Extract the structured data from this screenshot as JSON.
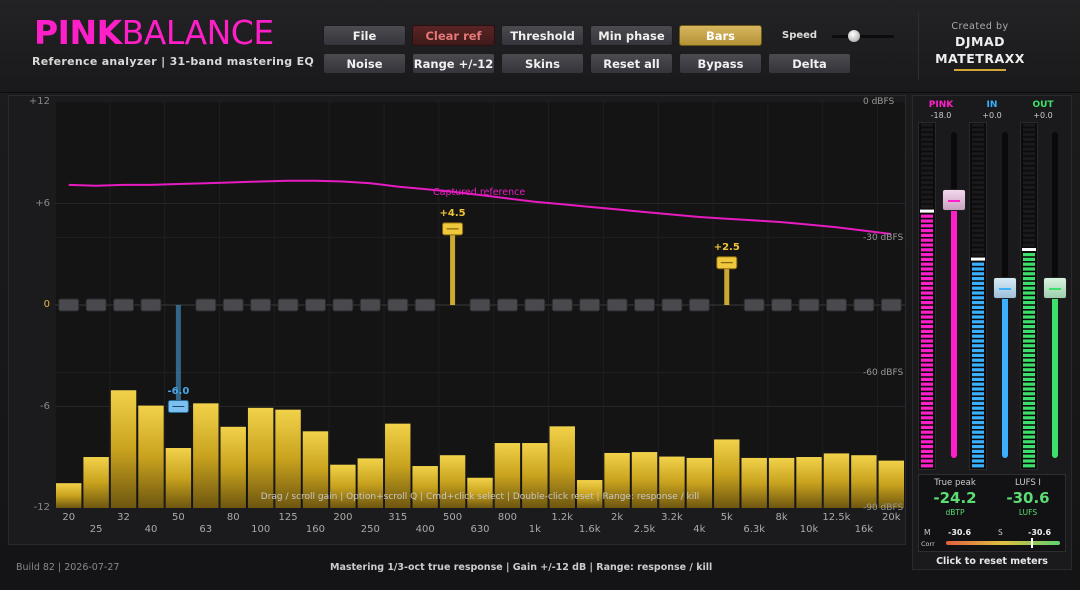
{
  "brand": {
    "name_bold": "PINK",
    "name_light": "BALANCE",
    "subtitle": "Reference analyzer  |  31-band mastering EQ"
  },
  "toolbar": {
    "row1": [
      {
        "id": "file",
        "label": "File",
        "state": "normal"
      },
      {
        "id": "clear-ref",
        "label": "Clear ref",
        "state": "alert"
      },
      {
        "id": "threshold",
        "label": "Threshold",
        "state": "normal"
      },
      {
        "id": "min-phase",
        "label": "Min phase",
        "state": "normal"
      },
      {
        "id": "bars",
        "label": "Bars",
        "state": "active"
      }
    ],
    "row2": [
      {
        "id": "noise",
        "label": "Noise",
        "state": "normal"
      },
      {
        "id": "range",
        "label": "Range +/-12",
        "state": "normal"
      },
      {
        "id": "skins",
        "label": "Skins",
        "state": "normal"
      },
      {
        "id": "reset-all",
        "label": "Reset all",
        "state": "normal"
      },
      {
        "id": "bypass",
        "label": "Bypass",
        "state": "normal"
      },
      {
        "id": "delta",
        "label": "Delta",
        "state": "normal"
      }
    ],
    "speed_label": "Speed",
    "speed_value": 0.35
  },
  "credits": {
    "created_by": "Created by",
    "author_line1": "DJMAD",
    "author_line2": "MATETRAXX"
  },
  "graph": {
    "y_left_ticks": [
      "+12",
      "+6",
      "0",
      "-6",
      "-12"
    ],
    "y_right_ticks": [
      "0 dBFS",
      "-30 dBFS",
      "-60 dBFS",
      "-90 dBFS"
    ],
    "freq_top_row": [
      "20",
      "32",
      "50",
      "80",
      "125",
      "200",
      "315",
      "500",
      "800",
      "1.2k",
      "2k",
      "3.2k",
      "5k",
      "8k",
      "12.5k",
      "20k"
    ],
    "freq_bottom_row": [
      "25",
      "40",
      "63",
      "100",
      "160",
      "250",
      "400",
      "630",
      "1k",
      "1.6k",
      "2.5k",
      "4k",
      "6.3k",
      "10k",
      "16k"
    ],
    "reference_label": "Captured reference",
    "hint": "Drag / scroll gain  |  Option+scroll Q  |  Cmd+click select  |  Double-click reset  |  Range: response / kill",
    "bands": [
      "20",
      "25",
      "31.5",
      "40",
      "50",
      "63",
      "80",
      "100",
      "125",
      "160",
      "200",
      "250",
      "315",
      "400",
      "500",
      "630",
      "800",
      "1k",
      "1.25k",
      "1.6k",
      "2k",
      "2.5k",
      "3.15k",
      "4k",
      "5k",
      "6.3k",
      "8k",
      "10k",
      "12.5k",
      "16k",
      "20k"
    ],
    "band_gain_db": [
      0,
      0,
      0,
      0,
      -6.0,
      0,
      0,
      0,
      0,
      0,
      0,
      0,
      0,
      0,
      4.5,
      0,
      0,
      0,
      0,
      0,
      0,
      0,
      0,
      0,
      2.5,
      0,
      0,
      0,
      0,
      0,
      0
    ],
    "band_gain_labels": [
      {
        "band": 4,
        "text": "-6.0",
        "color": "#4aa8e8"
      },
      {
        "band": 14,
        "text": "+4.5",
        "color": "#f0c43a"
      },
      {
        "band": 24,
        "text": "+2.5",
        "color": "#f0c43a"
      }
    ],
    "spectrum_dbfs": [
      -84.5,
      -78.7,
      -63.9,
      -67.3,
      -76.7,
      -66.8,
      -72.0,
      -67.8,
      -68.2,
      -73.0,
      -80.4,
      -79.0,
      -71.3,
      -80.7,
      -78.3,
      -83.3,
      -75.6,
      -75.6,
      -71.9,
      -83.8,
      -77.8,
      -77.6,
      -78.6,
      -78.9,
      -74.8,
      -78.9,
      -78.9,
      -78.7,
      -77.9,
      -78.3,
      -79.5
    ],
    "reference_curve_db": [
      7.1,
      7.05,
      7.1,
      7.1,
      7.15,
      7.2,
      7.25,
      7.3,
      7.35,
      7.35,
      7.3,
      7.2,
      7.0,
      6.85,
      6.7,
      6.5,
      6.3,
      6.1,
      5.95,
      5.8,
      5.65,
      5.5,
      5.35,
      5.2,
      5.1,
      5.0,
      4.9,
      4.75,
      4.6,
      4.4,
      4.2
    ]
  },
  "footer": {
    "build": "Build 82  |  2026-07-27",
    "mode": "Mastering 1/3-oct true response  |  Gain +/-12 dB  |  Range: response / kill"
  },
  "meters": {
    "pink": {
      "title": "PINK",
      "value": "-18.0",
      "color": "#ff1fc8",
      "level": 0.74,
      "fader": 0.79
    },
    "in": {
      "title": "IN",
      "value": "+0.0",
      "color": "#3ab0ff",
      "level": 0.6,
      "fader": 0.52
    },
    "out": {
      "title": "OUT",
      "value": "+0.0",
      "color": "#3ce06a",
      "level": 0.62,
      "fader": 0.52
    },
    "true_peak_label": "True peak",
    "true_peak_value": "-24.2",
    "true_peak_unit": "dBTP",
    "lufs_label": "LUFS I",
    "lufs_value": "-30.6",
    "lufs_unit": "LUFS",
    "m_label": "M",
    "m_value": "-30.6",
    "s_label": "S",
    "s_value": "-30.6",
    "corr_label": "Corr",
    "corr_value": 0.5,
    "reset_label": "Click to reset meters"
  },
  "colors": {
    "accent_pink": "#ff1fc8",
    "gold": "#d8b040",
    "blue": "#3ab0ff",
    "green": "#3ce06a",
    "alert_red": "#e57878"
  }
}
